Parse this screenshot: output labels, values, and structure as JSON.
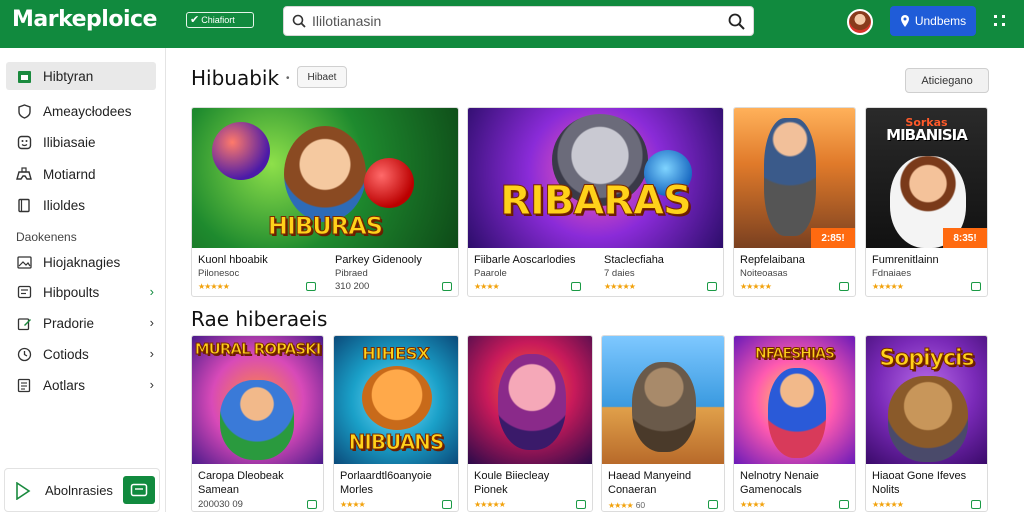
{
  "header": {
    "brand": "Markeploice",
    "badge": "Chiafiort",
    "search_placeholder": "Ililotianasin",
    "cta_label": "Undbems"
  },
  "sidebar": {
    "items": [
      {
        "label": "Hibtyran",
        "icon": "store-icon"
      },
      {
        "label": "Ameaycłodees",
        "icon": "shield-icon"
      },
      {
        "label": "Ilibiasaie",
        "icon": "smile-icon"
      },
      {
        "label": "Motiarnd",
        "icon": "game-controller-icon"
      },
      {
        "label": "Ilioldes",
        "icon": "book-icon"
      }
    ],
    "section_label": "Daokenens",
    "items2": [
      {
        "label": "Hiojaknagies",
        "icon": "image-icon"
      },
      {
        "label": "Hibpoults",
        "icon": "card-icon"
      },
      {
        "label": "Pradorie",
        "icon": "edit-icon"
      },
      {
        "label": "Cotiods",
        "icon": "clock-icon"
      },
      {
        "label": "Aotlars",
        "icon": "list-icon"
      }
    ],
    "footer_label": "Abolnrasies"
  },
  "main": {
    "section1_title": "Hibuabik",
    "section1_chip": "Hibaet",
    "filter_label": "Aticiegano",
    "section2_title": "Rae hiberaeis",
    "row1": [
      {
        "art_title": "HIBURAS",
        "title": "Kuonl hboabik",
        "subtitle": "Pilonesoc",
        "rating": "★★★★★",
        "rating_text": ""
      },
      {
        "art_title": "",
        "title": "Parkey Gidenooly",
        "subtitle": "Pibraed",
        "rating": "",
        "rating_text": "310 200"
      },
      {
        "art_title": "RIBARAS",
        "title": "Fiibarle Aoscarlodies",
        "subtitle": "Paarole",
        "rating": "★★★★",
        "rating_text": ""
      },
      {
        "art_title": "",
        "title": "Staclecfiaha",
        "subtitle": "7 daies",
        "rating": "★★★★★",
        "rating_text": ""
      },
      {
        "art_title": "",
        "title": "Repfelaibana",
        "subtitle": "Noiteoasas",
        "rating": "★★★★★",
        "rating_text": "",
        "ribbon": "2:85!"
      },
      {
        "art_title": "MIBANISIA",
        "art_top": "Sorkas",
        "title": "Fumrenitlainn",
        "subtitle": "Fdnaiaes",
        "rating": "★★★★★",
        "rating_text": "",
        "ribbon": "8:35!"
      }
    ],
    "row2": [
      {
        "art_title": "MURAL ROPASKI",
        "title": "Caropa Dleobeak",
        "subtitle": "Samean",
        "rating": "",
        "rating_text": "200030 09"
      },
      {
        "art_title": "NIBUANS",
        "art_top": "HIHESX",
        "title": "Porlaardtl6oanyoie",
        "subtitle": "Morles",
        "rating": "★★★★",
        "rating_text": ""
      },
      {
        "art_title": "",
        "title": "Koule Biiecleay",
        "subtitle": "Pionek",
        "rating": "★★★★★",
        "rating_text": ""
      },
      {
        "art_title": "",
        "title": "Haead Manyeind",
        "subtitle": "Conaeran",
        "rating": "★★★★",
        "rating_text": "60"
      },
      {
        "art_title": "NFAESHIAS",
        "title": "Nelnotry Nenaie",
        "subtitle": "Gamenocals",
        "rating": "★★★★",
        "rating_text": ""
      },
      {
        "art_title": "Sopiycis",
        "title": "Hiaoat Gone Ifeves",
        "subtitle": "Nolits",
        "rating": "★★★★★",
        "rating_text": ""
      }
    ]
  }
}
